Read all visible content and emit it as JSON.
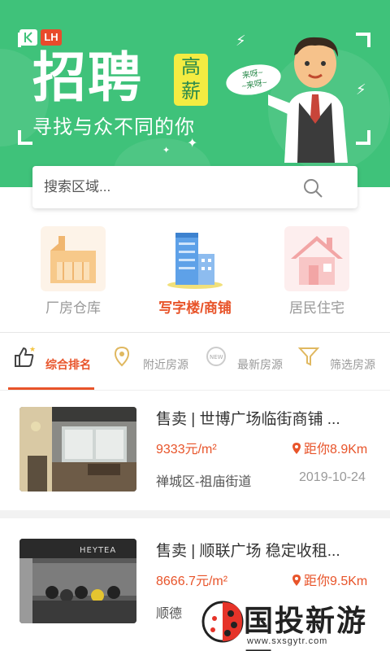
{
  "banner": {
    "logo_text": "LH",
    "title": "招聘",
    "badge": "高\n薪",
    "subtitle": "寻找与众不同的你",
    "bubble": "来呀~\n~来呀~",
    "colors": {
      "background": "#3fc27a",
      "badge": "#f4ec42"
    }
  },
  "search": {
    "placeholder": "搜索区域..."
  },
  "categories": [
    {
      "label": "厂房仓库",
      "icon": "factory-icon",
      "active": false
    },
    {
      "label": "写字楼/商铺",
      "icon": "office-building-icon",
      "active": true
    },
    {
      "label": "居民住宅",
      "icon": "house-icon",
      "active": false
    }
  ],
  "tabs": [
    {
      "label": "综合排名",
      "icon": "thumbs-up-icon",
      "active": true
    },
    {
      "label": "附近房源",
      "icon": "location-icon",
      "active": false
    },
    {
      "label": "最新房源",
      "icon": "new-badge-icon",
      "active": false
    },
    {
      "label": "筛选房源",
      "icon": "filter-icon",
      "active": false
    }
  ],
  "listings": [
    {
      "title": "售卖 | 世博广场临街商铺 ...",
      "price": "9333元/m²",
      "distance": "距你8.9Km",
      "area": "禅城区-祖庙街道",
      "date": "2019-10-24"
    },
    {
      "title": "售卖 | 顺联广场 稳定收租...",
      "price": "8666.7元/m²",
      "distance": "距你9.5Km",
      "area": "顺德",
      "date": "",
      "sign_text": "HEYTEA"
    }
  ],
  "watermark": {
    "text": "国投新游网",
    "url": "www.sxsgytr.com"
  },
  "colors": {
    "accent": "#e8542a"
  }
}
